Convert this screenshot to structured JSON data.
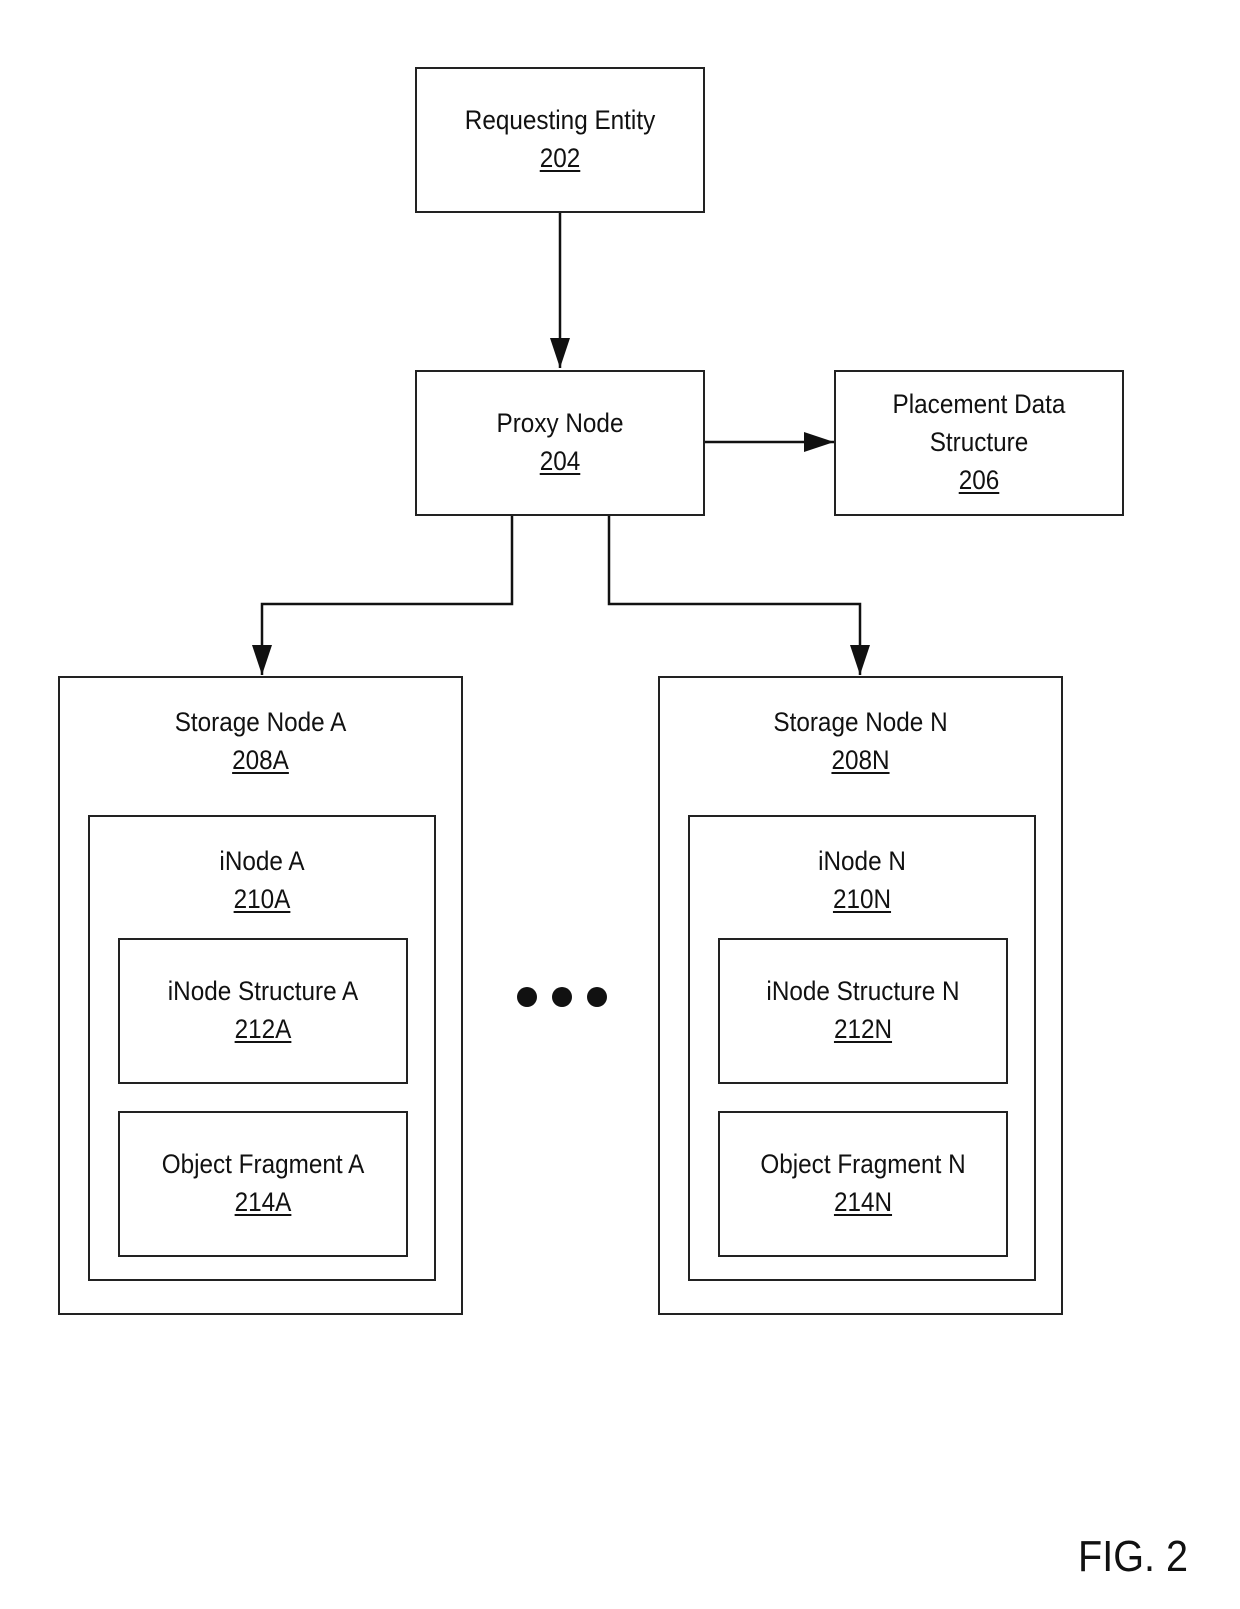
{
  "figure_label": "FIG. 2",
  "nodes": {
    "requesting_entity": {
      "title": "Requesting Entity",
      "ref": "202"
    },
    "proxy_node": {
      "title": "Proxy Node",
      "ref": "204"
    },
    "placement": {
      "title_line1": "Placement Data",
      "title_line2": "Structure",
      "ref": "206"
    },
    "storage_a": {
      "title": "Storage Node A",
      "ref": "208A",
      "inode": {
        "title": "iNode A",
        "ref": "210A"
      },
      "inode_structure": {
        "title": "iNode Structure A",
        "ref": "212A"
      },
      "object_fragment": {
        "title": "Object Fragment A",
        "ref": "214A"
      }
    },
    "storage_n": {
      "title": "Storage Node N",
      "ref": "208N",
      "inode": {
        "title": "iNode N",
        "ref": "210N"
      },
      "inode_structure": {
        "title": "iNode Structure N",
        "ref": "212N"
      },
      "object_fragment": {
        "title": "Object Fragment N",
        "ref": "214N"
      }
    }
  },
  "ellipsis": "...",
  "connections": [
    {
      "from": "202",
      "to": "204",
      "direction": "bidirectional"
    },
    {
      "from": "204",
      "to": "206",
      "direction": "bidirectional"
    },
    {
      "from": "204",
      "to": "208A",
      "direction": "bidirectional"
    },
    {
      "from": "204",
      "to": "208N",
      "direction": "bidirectional"
    }
  ]
}
